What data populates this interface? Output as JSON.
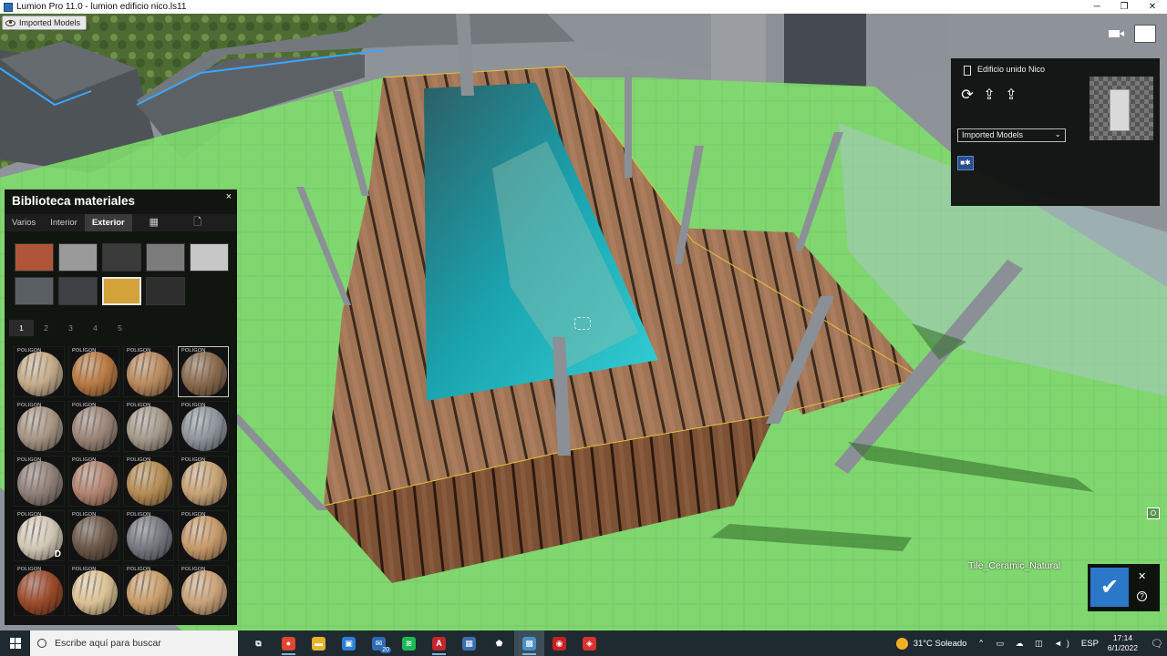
{
  "window": {
    "title": "Lumion Pro 11.0 - lumion edificio nico.ls11",
    "minimize": "─",
    "maximize": "❐",
    "close": "✕"
  },
  "viewport": {
    "imported_models_button": "Imported Models",
    "selected_material_name": "Tile_Ceramic_Natural",
    "zoom_toggle_label": "O"
  },
  "object_panel": {
    "name": "Edificio unido Nico",
    "tools": [
      "⟳",
      "⇪",
      "⇪"
    ],
    "category_select": "Imported Models",
    "material_chip": "■✱"
  },
  "material_library": {
    "title": "Biblioteca materiales",
    "close": "×",
    "tabs": [
      {
        "label": "Varios",
        "active": false
      },
      {
        "label": "Interior",
        "active": false
      },
      {
        "label": "Exterior",
        "active": true
      }
    ],
    "grid_icon": "▦",
    "file_icon": "🗋",
    "categories": [
      {
        "name": "brick",
        "color": "#b0553a",
        "selected": false
      },
      {
        "name": "concrete",
        "color": "#9a9a9a",
        "selected": false
      },
      {
        "name": "metal-dark",
        "color": "#3b3b3b",
        "selected": false
      },
      {
        "name": "diamond-plate",
        "color": "#7c7c7c",
        "selected": false
      },
      {
        "name": "plaster",
        "color": "#c7c7c7",
        "selected": false
      },
      {
        "name": "roof-tile",
        "color": "#5a5f63",
        "selected": false
      },
      {
        "name": "granite",
        "color": "#3e4245",
        "selected": false
      },
      {
        "name": "sandstone",
        "color": "#d3a33a",
        "selected": true
      },
      {
        "name": "asphalt",
        "color": "#2e2e2e",
        "selected": false
      }
    ],
    "pages": [
      {
        "label": "1",
        "active": true
      },
      {
        "label": "2",
        "active": false
      },
      {
        "label": "3",
        "active": false
      },
      {
        "label": "4",
        "active": false
      },
      {
        "label": "5",
        "active": false
      }
    ],
    "tag": "POLIGON",
    "materials": [
      {
        "color": "#c4ac8a",
        "selected": false,
        "badge": ""
      },
      {
        "color": "#b77a43",
        "selected": false,
        "badge": ""
      },
      {
        "color": "#b8895e",
        "selected": false,
        "badge": ""
      },
      {
        "color": "#8a6a4e",
        "selected": true,
        "badge": ""
      },
      {
        "color": "#a89585",
        "selected": false,
        "badge": ""
      },
      {
        "color": "#9a8578",
        "selected": false,
        "badge": ""
      },
      {
        "color": "#a59a8c",
        "selected": false,
        "badge": ""
      },
      {
        "color": "#8f959c",
        "selected": false,
        "badge": ""
      },
      {
        "color": "#8f8078",
        "selected": false,
        "badge": ""
      },
      {
        "color": "#b08470",
        "selected": false,
        "badge": ""
      },
      {
        "color": "#b58c55",
        "selected": false,
        "badge": ""
      },
      {
        "color": "#c7a377",
        "selected": false,
        "badge": ""
      },
      {
        "color": "#d2c7b6",
        "selected": false,
        "badge": "D"
      },
      {
        "color": "#6b5848",
        "selected": false,
        "badge": ""
      },
      {
        "color": "#767a80",
        "selected": false,
        "badge": ""
      },
      {
        "color": "#c79a6b",
        "selected": false,
        "badge": ""
      },
      {
        "color": "#9c4b2c",
        "selected": false,
        "badge": ""
      },
      {
        "color": "#dbc195",
        "selected": false,
        "badge": ""
      },
      {
        "color": "#c99e6b",
        "selected": false,
        "badge": ""
      },
      {
        "color": "#c9a27a",
        "selected": false,
        "badge": ""
      }
    ]
  },
  "confirm": {
    "ok": "✔",
    "cancel": "✕",
    "help": "?"
  },
  "taskbar": {
    "search_placeholder": "Escribe aquí para buscar",
    "apps": [
      {
        "name": "task-view",
        "glyph": "⧉",
        "color": "transparent",
        "running": false,
        "active": false,
        "badge": ""
      },
      {
        "name": "chrome",
        "glyph": "●",
        "color": "#e0452f",
        "running": true,
        "active": false,
        "badge": ""
      },
      {
        "name": "file-explorer",
        "glyph": "▬",
        "color": "#e8b22c",
        "running": false,
        "active": false,
        "badge": ""
      },
      {
        "name": "store",
        "glyph": "▣",
        "color": "#2d7fd6",
        "running": false,
        "active": false,
        "badge": ""
      },
      {
        "name": "mail",
        "glyph": "✉",
        "color": "#2d6bb5",
        "running": false,
        "active": false,
        "badge": "20"
      },
      {
        "name": "spotify",
        "glyph": "≋",
        "color": "#1db954",
        "running": false,
        "active": false,
        "badge": ""
      },
      {
        "name": "autocad",
        "glyph": "A",
        "color": "#c4262e",
        "running": true,
        "active": false,
        "badge": ""
      },
      {
        "name": "calculator",
        "glyph": "▦",
        "color": "#3a6fb0",
        "running": false,
        "active": false,
        "badge": ""
      },
      {
        "name": "security",
        "glyph": "⬟",
        "color": "transparent",
        "running": false,
        "active": false,
        "badge": ""
      },
      {
        "name": "lumion",
        "glyph": "▩",
        "color": "#4a90c6",
        "running": true,
        "active": true,
        "badge": ""
      },
      {
        "name": "app-red-1",
        "glyph": "◉",
        "color": "#c72020",
        "running": false,
        "active": false,
        "badge": ""
      },
      {
        "name": "app-red-2",
        "glyph": "◈",
        "color": "#d8332e",
        "running": false,
        "active": false,
        "badge": ""
      }
    ],
    "weather": "31°C  Soleado",
    "tray_icons": "⌃ ▭ ☁ ◫ ◄)",
    "language": "ESP",
    "time": "17:14",
    "date": "6/1/2022",
    "notifications": "🗨"
  }
}
